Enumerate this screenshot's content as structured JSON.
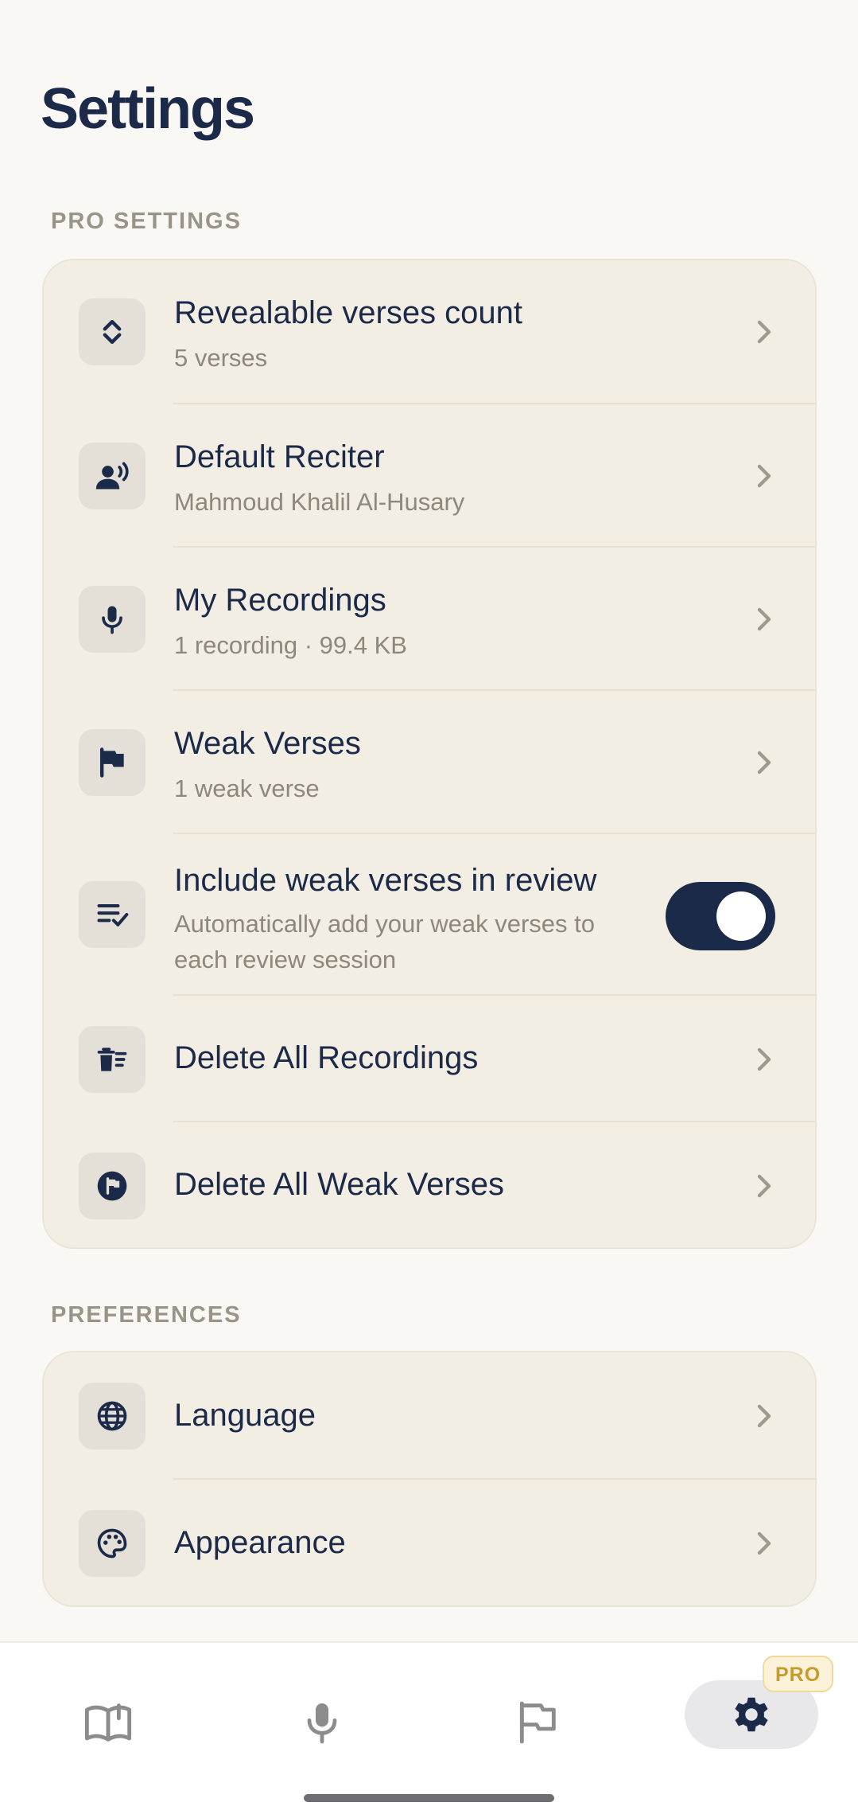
{
  "header": {
    "title": "Settings"
  },
  "sections": {
    "pro": {
      "label": "PRO SETTINGS",
      "items": [
        {
          "title": "Revealable verses count",
          "subtitle": "5 verses",
          "icon": "expand-vertical-icon"
        },
        {
          "title": "Default Reciter",
          "subtitle": "Mahmoud Khalil Al-Husary",
          "icon": "record-voice-icon"
        },
        {
          "title": "My Recordings",
          "subtitle": "1 recording · 99.4 KB",
          "icon": "microphone-icon"
        },
        {
          "title": "Weak Verses",
          "subtitle": "1 weak verse",
          "icon": "flag-icon"
        },
        {
          "title": "Include weak verses in review",
          "subtitle": "Automatically add your weak verses to each review session",
          "icon": "playlist-check-icon",
          "toggle": true
        },
        {
          "title": "Delete All Recordings",
          "icon": "delete-sweep-icon"
        },
        {
          "title": "Delete All Weak Verses",
          "icon": "flag-circle-icon"
        }
      ]
    },
    "preferences": {
      "label": "PREFERENCES",
      "items": [
        {
          "title": "Language",
          "icon": "globe-icon"
        },
        {
          "title": "Appearance",
          "icon": "palette-icon"
        }
      ]
    }
  },
  "tabbar": {
    "tabs": [
      {
        "icon": "book-icon"
      },
      {
        "icon": "microphone-icon"
      },
      {
        "icon": "flag-icon"
      },
      {
        "icon": "gear-icon",
        "active": true
      }
    ],
    "pro_badge": "PRO"
  },
  "colors": {
    "accent": "#1c2a4a",
    "background": "#faf8f4",
    "card": "#f3eee4",
    "subtitle": "#8d877c",
    "pro_badge": "#c99a2a"
  }
}
